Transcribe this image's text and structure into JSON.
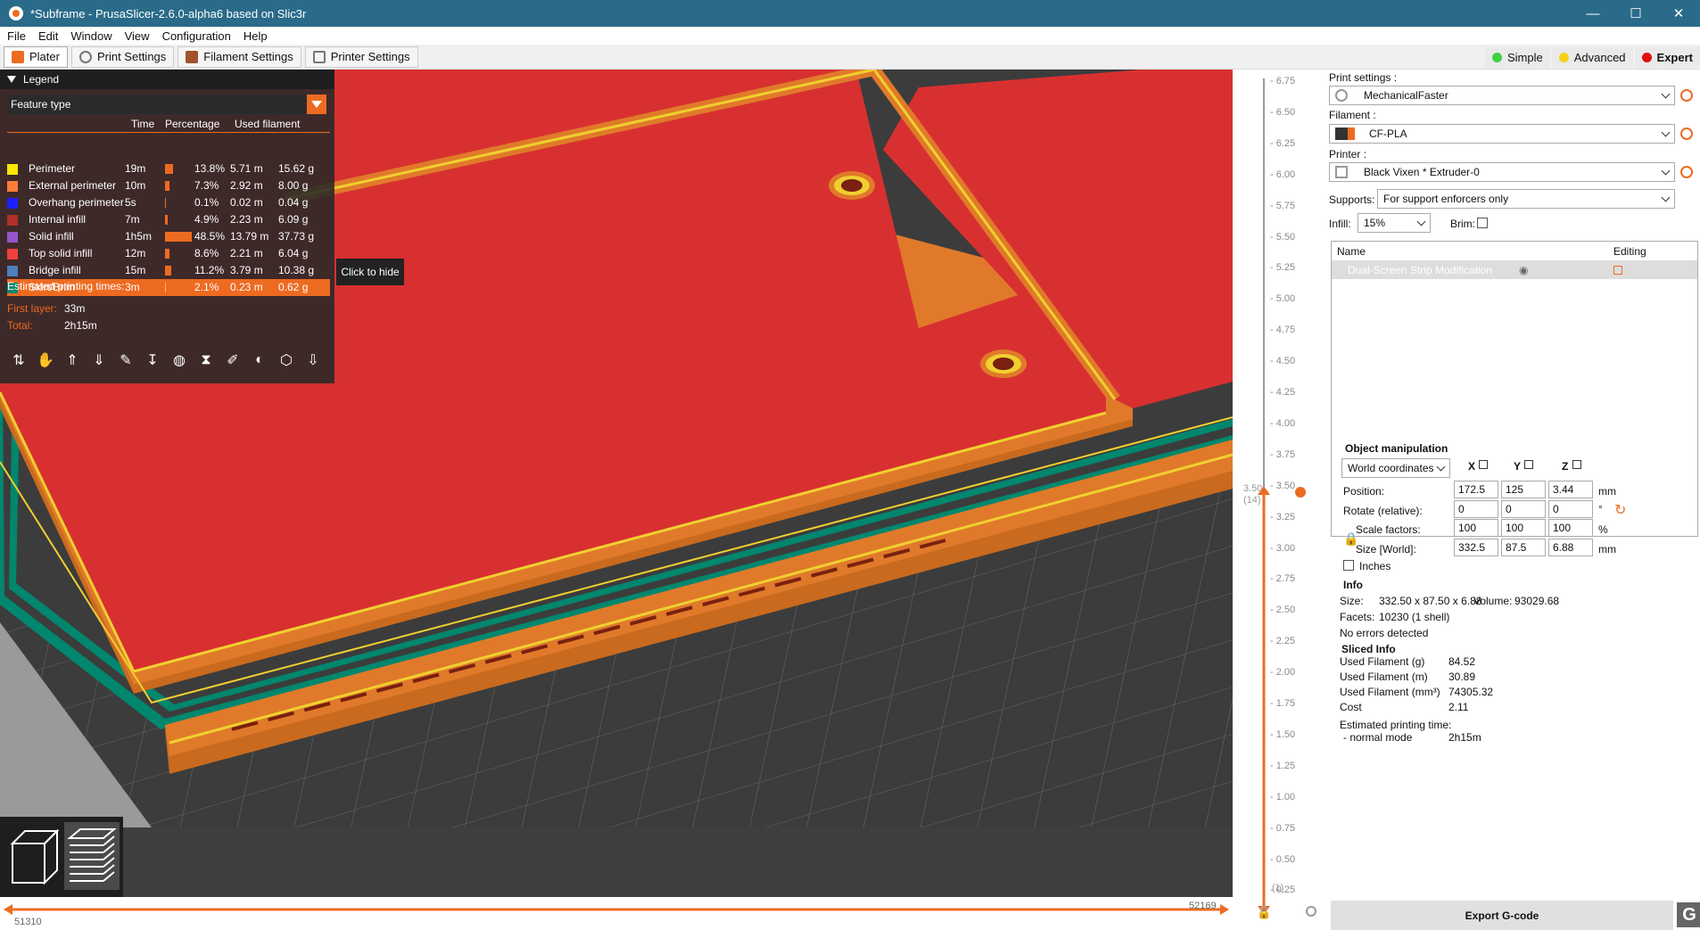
{
  "window": {
    "title": "*Subframe - PrusaSlicer-2.6.0-alpha6 based on Slic3r",
    "minimize": "—",
    "maximize": "☐",
    "close": "✕"
  },
  "menu": [
    "File",
    "Edit",
    "Window",
    "View",
    "Configuration",
    "Help"
  ],
  "tabs": [
    {
      "label": "Plater",
      "active": true
    },
    {
      "label": "Print Settings"
    },
    {
      "label": "Filament Settings"
    },
    {
      "label": "Printer Settings"
    }
  ],
  "modes": [
    {
      "label": "Simple",
      "color": "#3fcf3f"
    },
    {
      "label": "Advanced",
      "color": "#f5d21a"
    },
    {
      "label": "Expert",
      "color": "#e01010",
      "active": true
    }
  ],
  "legend": {
    "title": "Legend",
    "view_type": "Feature type",
    "columns": {
      "time": "Time",
      "percentage": "Percentage",
      "used": "Used filament"
    },
    "rows": [
      {
        "name": "Perimeter",
        "color": "#ffe600",
        "time": "19m",
        "pct": "13.8%",
        "pct_value": 13.8,
        "len": "5.71 m",
        "weight": "15.62 g"
      },
      {
        "name": "External perimeter",
        "color": "#ff7d38",
        "time": "10m",
        "pct": "7.3%",
        "pct_value": 7.3,
        "len": "2.92 m",
        "weight": "8.00 g"
      },
      {
        "name": "Overhang perimeter",
        "color": "#1f1fff",
        "time": "5s",
        "pct": "0.1%",
        "pct_value": 0.1,
        "len": "0.02 m",
        "weight": "0.04 g"
      },
      {
        "name": "Internal infill",
        "color": "#b03029",
        "time": "7m",
        "pct": "4.9%",
        "pct_value": 4.9,
        "len": "2.23 m",
        "weight": "6.09 g"
      },
      {
        "name": "Solid infill",
        "color": "#9654cc",
        "time": "1h5m",
        "pct": "48.5%",
        "pct_value": 48.5,
        "len": "13.79 m",
        "weight": "37.73 g"
      },
      {
        "name": "Top solid infill",
        "color": "#f04040",
        "time": "12m",
        "pct": "8.6%",
        "pct_value": 8.6,
        "len": "2.21 m",
        "weight": "6.04 g"
      },
      {
        "name": "Bridge infill",
        "color": "#4d80ba",
        "time": "15m",
        "pct": "11.2%",
        "pct_value": 11.2,
        "len": "3.79 m",
        "weight": "10.38 g"
      },
      {
        "name": "Skirt/Brim",
        "color": "#00876e",
        "time": "3m",
        "pct": "2.1%",
        "pct_value": 2.1,
        "len": "0.23 m",
        "weight": "0.62 g",
        "highlighted": true
      }
    ],
    "estimated_label": "Estimated printing times:",
    "first_layer_label": "First layer:",
    "first_layer": "33m",
    "total_label": "Total:",
    "total": "2h15m"
  },
  "tooltip": "Click to hide",
  "vslider": {
    "ticks": [
      "6.75",
      "6.50",
      "6.25",
      "6.00",
      "5.75",
      "5.50",
      "5.25",
      "5.00",
      "4.75",
      "4.50",
      "4.25",
      "4.00",
      "3.75",
      "3.50",
      "3.25",
      "3.00",
      "2.75",
      "2.50",
      "2.25",
      "2.00",
      "1.75",
      "1.50",
      "1.25",
      "1.00",
      "0.75",
      "0.50",
      "0.25"
    ],
    "current": "3.50",
    "current_layer": "(14)",
    "bottom_layer": "(1)"
  },
  "hslider": {
    "left": "51310",
    "right": "52169"
  },
  "panel": {
    "print_label": "Print settings :",
    "print_value": "MechanicalFaster",
    "filament_label": "Filament :",
    "filament_value": "CF-PLA",
    "printer_label": "Printer :",
    "printer_value": "Black Vixen * Extruder-0",
    "supports_label": "Supports:",
    "supports_value": "For support enforcers only",
    "infill_label": "Infill:",
    "infill_value": "15%",
    "brim_label": "Brim:",
    "list_name": "Name",
    "list_editing": "Editing",
    "list_item": "Dual-Screen Strip Modification",
    "om_title": "Object manipulation",
    "coord_system": "World coordinates",
    "axis": [
      "X",
      "Y",
      "Z"
    ],
    "position_label": "Position:",
    "position": [
      "172.5",
      "125",
      "3.44"
    ],
    "rotate_label": "Rotate (relative):",
    "rotate": [
      "0",
      "0",
      "0"
    ],
    "scale_label": "Scale factors:",
    "scale": [
      "100",
      "100",
      "100"
    ],
    "size_label": "Size [World]:",
    "size": [
      "332.5",
      "87.5",
      "6.88"
    ],
    "unit_mm": "mm",
    "unit_deg": "°",
    "unit_pct": "%",
    "inches_label": "Inches",
    "info_title": "Info",
    "size_info_label": "Size:",
    "size_info": "332.50 x 87.50 x 6.88",
    "volume_label": "Volume:",
    "volume": "93029.68",
    "facets_label": "Facets:",
    "facets": "10230 (1 shell)",
    "errors": "No errors detected",
    "sliced_title": "Sliced Info",
    "sliced_rows": [
      {
        "label": "Used Filament (g)",
        "value": "84.52"
      },
      {
        "label": "Used Filament (m)",
        "value": "30.89"
      },
      {
        "label": "Used Filament (mm³)",
        "value": "74305.32"
      },
      {
        "label": "Cost",
        "value": "2.11"
      }
    ],
    "est_label": "Estimated printing time:",
    "normal_mode_label": "- normal mode",
    "normal_mode": "2h15m",
    "export": "Export G-code"
  }
}
